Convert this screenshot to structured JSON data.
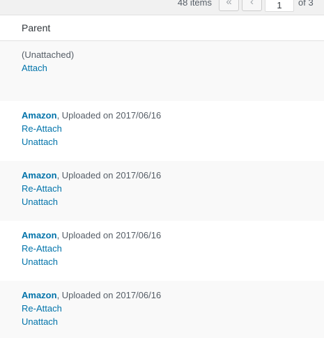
{
  "pagination": {
    "items_count": "48 items",
    "first_label": "«",
    "prev_label": "‹",
    "current_page": "1",
    "of_total": "of 3"
  },
  "table": {
    "column_header": "Parent",
    "rows": [
      {
        "status": "(Unattached)",
        "action": "Attach"
      },
      {
        "parent": "Amazon",
        "uploaded": ", Uploaded on 2017/06/16",
        "action1": "Re-Attach",
        "action2": "Unattach"
      },
      {
        "parent": "Amazon",
        "uploaded": ", Uploaded on 2017/06/16",
        "action1": "Re-Attach",
        "action2": "Unattach"
      },
      {
        "parent": "Amazon",
        "uploaded": ", Uploaded on 2017/06/16",
        "action1": "Re-Attach",
        "action2": "Unattach"
      },
      {
        "parent": "Amazon",
        "uploaded": ", Uploaded on 2017/06/16",
        "action1": "Re-Attach",
        "action2": "Unattach"
      }
    ]
  },
  "colors": {
    "link": "#0073aa",
    "text": "#555d66",
    "alt_row": "#f9f9f9"
  }
}
